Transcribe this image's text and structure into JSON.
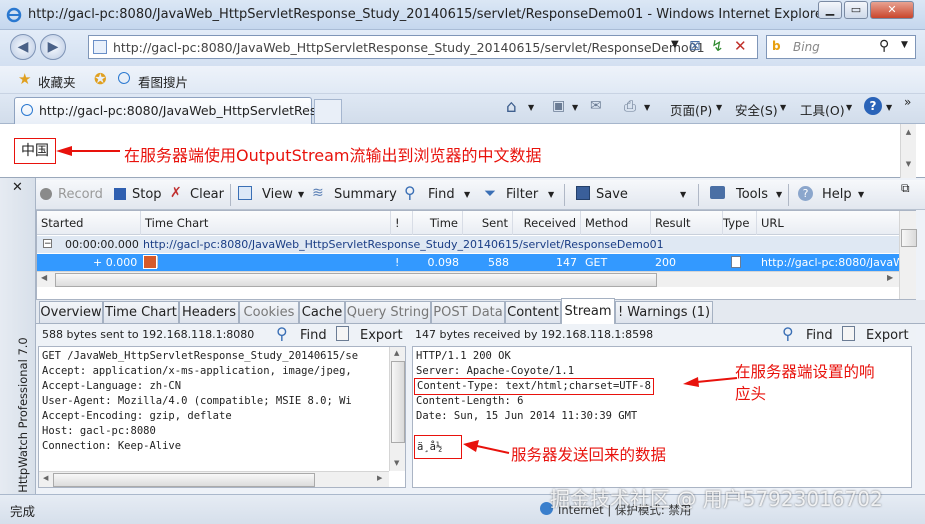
{
  "window": {
    "title": "http://gacl-pc:8080/JavaWeb_HttpServletResponse_Study_20140615/servlet/ResponseDemo01 - Windows Internet Explorer"
  },
  "nav": {
    "url": "http://gacl-pc:8080/JavaWeb_HttpServletResponse_Study_20140615/servlet/ResponseDemo01",
    "search_placeholder": "Bing"
  },
  "favbar": {
    "favorites": "收藏夹",
    "item1": "看图搜片"
  },
  "tab": {
    "label": "http://gacl-pc:8080/JavaWeb_HttpServletRes..."
  },
  "commandbar": {
    "page": "页面(P)",
    "safety": "安全(S)",
    "tools": "工具(O)"
  },
  "page": {
    "text": "中国",
    "annotation": "在服务器端使用OutputStream流输出到浏览器的中文数据"
  },
  "httpwatch": {
    "side_label": "HttpWatch Professional 7.0",
    "toolbar": {
      "record": "Record",
      "stop": "Stop",
      "clear": "Clear",
      "view": "View",
      "summary": "Summary",
      "find": "Find",
      "filter": "Filter",
      "save": "Save",
      "tools": "Tools",
      "help": "Help"
    },
    "columns": {
      "started": "Started",
      "time_chart": "Time Chart",
      "bang": "!",
      "time": "Time",
      "sent": "Sent",
      "received": "Received",
      "method": "Method",
      "result": "Result",
      "type": "Type",
      "url": "URL"
    },
    "page_row": {
      "started": "00:00:00.000",
      "url": "http://gacl-pc:8080/JavaWeb_HttpServletResponse_Study_20140615/servlet/ResponseDemo01"
    },
    "request_row": {
      "started": "+ 0.000",
      "bang": "!",
      "time": "0.098",
      "sent": "588",
      "received": "147",
      "method": "GET",
      "result": "200",
      "url": "http://gacl-pc:8080/JavaWe"
    },
    "detail_tabs": [
      "Overview",
      "Time Chart",
      "Headers",
      "Cookies",
      "Cache",
      "Query String",
      "POST Data",
      "Content",
      "Stream",
      "! Warnings (1)"
    ],
    "left_pane": {
      "header": "588 bytes sent to 192.168.118.1:8080",
      "find": "Find",
      "export": "Export",
      "lines": [
        "GET /JavaWeb_HttpServletResponse_Study_20140615/se",
        "Accept: application/x-ms-application, image/jpeg,",
        "Accept-Language: zh-CN",
        "User-Agent: Mozilla/4.0 (compatible; MSIE 8.0; Wi",
        "Accept-Encoding: gzip, deflate",
        "Host: gacl-pc:8080",
        "Connection: Keep-Alive"
      ]
    },
    "right_pane": {
      "header": "147 bytes received by 192.168.118.1:8598",
      "find": "Find",
      "export": "Export",
      "lines": [
        "HTTP/1.1 200 OK",
        "Server: Apache-Coyote/1.1",
        "Content-Type: text/html;charset=UTF-8",
        "Content-Length: 6",
        "Date: Sun, 15 Jun 2014 11:30:39 GMT"
      ],
      "body": "ä¸­å½",
      "annotation1_line1": "在服务器端设置的响",
      "annotation1_line2": "应头",
      "annotation2": "服务器发送回来的数据"
    }
  },
  "status": {
    "done": "完成",
    "zone": "Internet | 保护模式: 禁用",
    "watermark": "掘金技术社区 @ 用户5792301670​2"
  },
  "colors": {
    "annotation_red": "#e8120c",
    "selected_row": "#3399ff"
  }
}
